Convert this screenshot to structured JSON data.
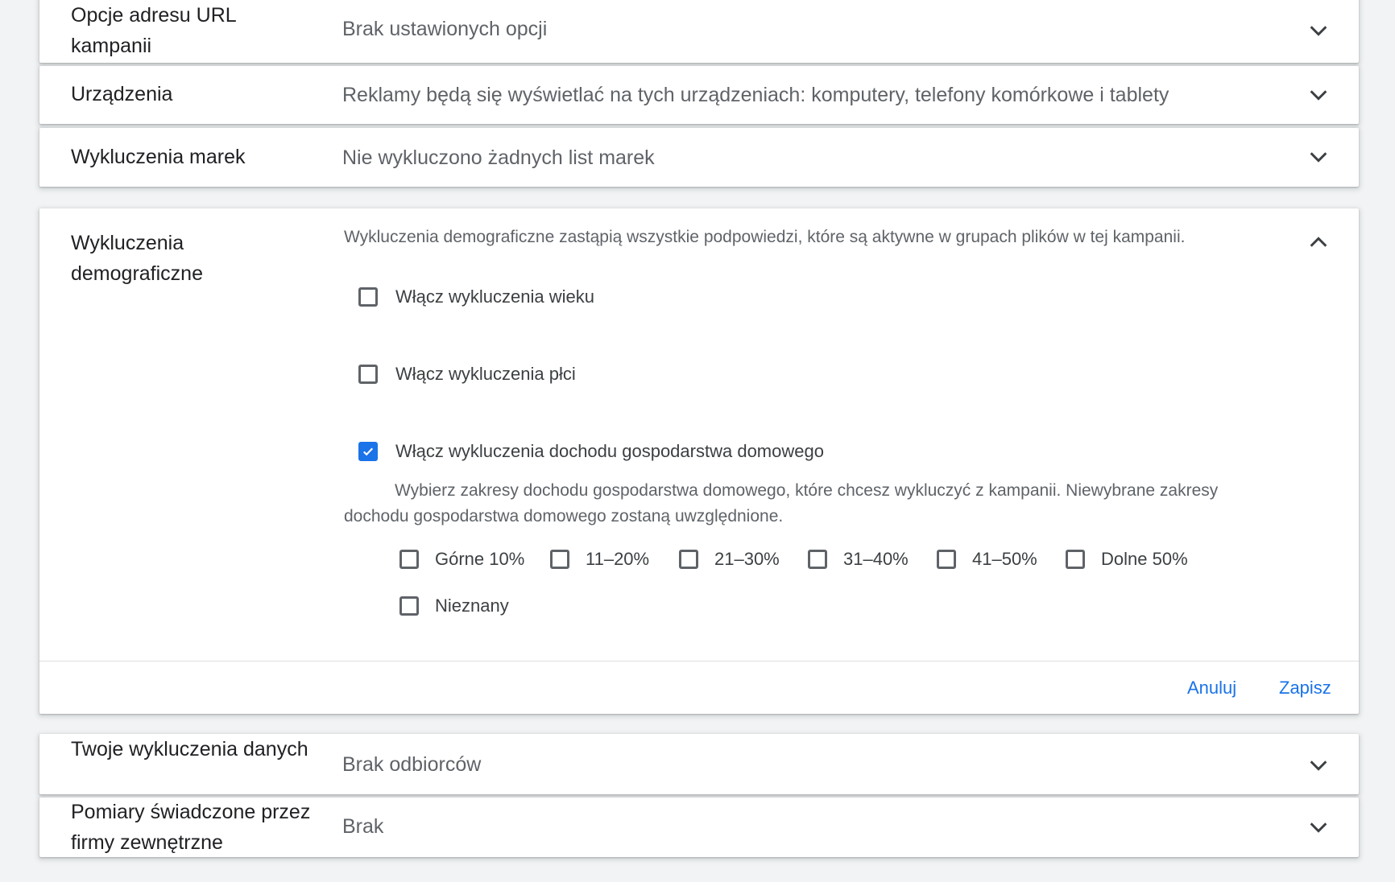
{
  "sections": {
    "url_options": {
      "label": "Opcje adresu URL kampanii",
      "summary": "Brak ustawionych opcji"
    },
    "devices": {
      "label": "Urządzenia",
      "summary": "Reklamy będą się wyświetlać na tych urządzeniach: komputery, telefony komórkowe i tablety"
    },
    "brand_exclusions": {
      "label": "Wykluczenia marek",
      "summary": "Nie wykluczono żadnych list marek"
    },
    "data_exclusions": {
      "label": "Twoje wykluczenia danych",
      "summary": "Brak odbiorców"
    },
    "third_party": {
      "label": "Pomiary świadczone przez firmy zewnętrzne",
      "summary": "Brak"
    }
  },
  "demographic": {
    "label": "Wykluczenia demograficzne",
    "notice": "Wykluczenia demograficzne zastąpią wszystkie podpowiedzi, które są aktywne w grupach plików w tej kampanii.",
    "age_label": "Włącz wykluczenia wieku",
    "age_checked": false,
    "gender_label": "Włącz wykluczenia płci",
    "gender_checked": false,
    "income_label": "Włącz wykluczenia dochodu gospodarstwa domowego",
    "income_checked": true,
    "income_help": "Wybierz zakresy dochodu gospodarstwa domowego, które chcesz wykluczyć z kampanii. Niewybrane zakresy dochodu gospodarstwa domowego zostaną uwzględnione.",
    "income_options": [
      "Górne 10%",
      "11–20%",
      "21–30%",
      "31–40%",
      "41–50%",
      "Dolne 50%",
      "Nieznany"
    ],
    "cancel_label": "Anuluj",
    "save_label": "Zapisz"
  },
  "colors": {
    "accent": "#1a73e8",
    "background": "#f1f3f4"
  },
  "icons": {
    "collapsed": "chevron-down-icon",
    "expanded": "chevron-up-icon"
  }
}
